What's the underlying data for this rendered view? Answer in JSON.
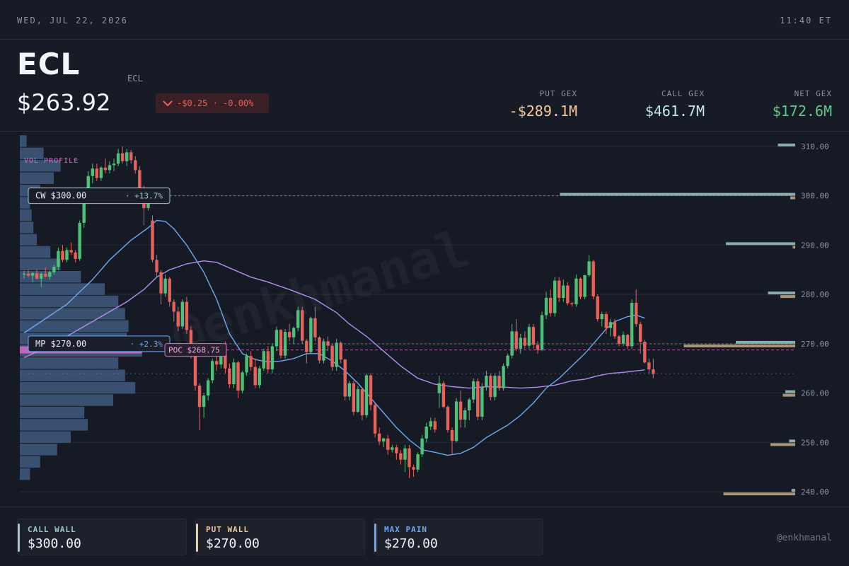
{
  "topbar": {
    "date": "WED, JUL 22, 2026",
    "time": "11:40 ET"
  },
  "header": {
    "ticker": "ECL",
    "ticker_sub": "ECL",
    "price": "$263.92",
    "change": "-$0.25 · -0.00%",
    "gex": [
      {
        "label": "PUT GEX",
        "value": "-$289.1M",
        "color": "#f2c99a"
      },
      {
        "label": "CALL GEX",
        "value": "$461.7M",
        "color": "#bfe8ea"
      },
      {
        "label": "NET GEX",
        "value": "$172.6M",
        "color": "#63c98a"
      }
    ]
  },
  "colors": {
    "up": "#4fc07a",
    "down": "#e8615a",
    "ma_fast": "#6fa8f0",
    "ma_slow": "#b48cf0",
    "vol": "#3f5a7e",
    "poc": "#e06ad0",
    "call": "#9fc7c7",
    "put": "#c4ad86"
  },
  "chart_data": {
    "type": "candlestick",
    "watermark": "@enkhmanal",
    "ylim": [
      237,
      313
    ],
    "yticks": [
      "310.00",
      "300.00",
      "290.00",
      "280.00",
      "270.00",
      "260.00",
      "250.00",
      "240.00"
    ],
    "ytick_values": [
      310,
      300,
      290,
      280,
      270,
      260,
      250,
      240
    ],
    "volume_profile_label": "VOL PROFILE",
    "volume_profile": [
      {
        "price": 311,
        "w": 0.04
      },
      {
        "price": 308.5,
        "w": 0.14
      },
      {
        "price": 306,
        "w": 0.24
      },
      {
        "price": 303.5,
        "w": 0.2
      },
      {
        "price": 301,
        "w": 0.12
      },
      {
        "price": 298.5,
        "w": 0.06
      },
      {
        "price": 296,
        "w": 0.07
      },
      {
        "price": 293.5,
        "w": 0.08
      },
      {
        "price": 291,
        "w": 0.1
      },
      {
        "price": 288.5,
        "w": 0.18
      },
      {
        "price": 286,
        "w": 0.24
      },
      {
        "price": 283.5,
        "w": 0.36
      },
      {
        "price": 281,
        "w": 0.5
      },
      {
        "price": 278.5,
        "w": 0.58
      },
      {
        "price": 276,
        "w": 0.62
      },
      {
        "price": 273.5,
        "w": 0.64
      },
      {
        "price": 271,
        "w": 0.63
      },
      {
        "price": 268.5,
        "w": 0.72
      },
      {
        "price": 266,
        "w": 0.58
      },
      {
        "price": 263.5,
        "w": 0.62
      },
      {
        "price": 261,
        "w": 0.68
      },
      {
        "price": 258.5,
        "w": 0.55
      },
      {
        "price": 256,
        "w": 0.38
      },
      {
        "price": 253.5,
        "w": 0.4
      },
      {
        "price": 251,
        "w": 0.3
      },
      {
        "price": 248.5,
        "w": 0.22
      },
      {
        "price": 246,
        "w": 0.12
      },
      {
        "price": 243.5,
        "w": 0.06
      }
    ],
    "candles": [
      [
        284,
        284.8,
        283.2,
        284.2
      ],
      [
        284.2,
        285,
        283.5,
        283.8
      ],
      [
        283.8,
        284.5,
        282.5,
        284.3
      ],
      [
        284.3,
        285,
        283,
        283.2
      ],
      [
        283.2,
        284.5,
        281.5,
        284.2
      ],
      [
        284.2,
        285.5,
        283.5,
        283.6
      ],
      [
        283.6,
        284.8,
        283,
        284.5
      ],
      [
        284.5,
        286,
        284,
        285.6
      ],
      [
        285.6,
        289.5,
        285,
        288.8
      ],
      [
        288.8,
        290,
        286.5,
        287
      ],
      [
        287,
        289.5,
        286.5,
        289
      ],
      [
        289,
        290.5,
        288,
        288.5
      ],
      [
        288.5,
        289,
        286.5,
        287.2
      ],
      [
        287.2,
        295,
        286.8,
        294.5
      ],
      [
        294.5,
        300,
        293.5,
        299.5
      ],
      [
        299.5,
        305,
        299,
        304
      ],
      [
        304,
        306.5,
        302.5,
        305.5
      ],
      [
        305.5,
        306.5,
        303,
        303.6
      ],
      [
        303.6,
        306,
        303,
        305.7
      ],
      [
        305.7,
        307.5,
        304.5,
        305.2
      ],
      [
        305.2,
        307,
        304.5,
        306.2
      ],
      [
        306.2,
        307.5,
        305,
        306.5
      ],
      [
        306.5,
        309.5,
        306,
        308.6
      ],
      [
        308.6,
        310,
        306.5,
        307
      ],
      [
        307,
        309.5,
        306,
        308.8
      ],
      [
        308.8,
        309.3,
        306.5,
        307.2
      ],
      [
        307.2,
        308,
        304.5,
        305.2
      ],
      [
        305.2,
        306,
        301,
        301.5
      ],
      [
        301.5,
        302,
        294,
        297.5
      ],
      [
        297.5,
        301,
        297,
        300.5
      ],
      [
        295,
        296,
        286.5,
        287
      ],
      [
        287,
        288,
        283.5,
        284.5
      ],
      [
        284.5,
        285,
        278,
        280.2
      ],
      [
        280.2,
        284,
        279.5,
        283.2
      ],
      [
        283.2,
        283.5,
        277.5,
        278.5
      ],
      [
        278.5,
        279,
        274.5,
        276.5
      ],
      [
        276.5,
        277.5,
        272.5,
        273.5
      ],
      [
        273.5,
        279,
        273,
        278.5
      ],
      [
        278.5,
        279.5,
        272,
        272.8
      ],
      [
        272.8,
        273.5,
        267,
        267.5
      ],
      [
        267.5,
        268,
        260.5,
        261.5
      ],
      [
        261.5,
        262,
        252.5,
        257.2
      ],
      [
        257.2,
        260,
        255,
        259.5
      ],
      [
        259.5,
        263,
        258.5,
        262.6
      ],
      [
        262.6,
        267,
        262,
        266.5
      ],
      [
        266.5,
        270,
        264.5,
        265.8
      ],
      [
        265.8,
        270,
        265,
        269.6
      ],
      [
        269.6,
        270.5,
        264,
        265
      ],
      [
        265,
        266,
        261,
        261.8
      ],
      [
        261.8,
        267,
        261,
        266.2
      ],
      [
        266.2,
        266.5,
        259,
        260.5
      ],
      [
        260.5,
        264.5,
        260,
        264.2
      ],
      [
        264.2,
        268,
        263.5,
        267.5
      ],
      [
        267.5,
        268.5,
        264.5,
        265.3
      ],
      [
        265.3,
        267,
        261,
        261.6
      ],
      [
        261.6,
        265.5,
        261,
        265
      ],
      [
        265,
        269,
        264.5,
        268.5
      ],
      [
        268.5,
        269.5,
        264,
        264.8
      ],
      [
        264.8,
        270,
        264,
        269.5
      ],
      [
        269.5,
        273.5,
        268.5,
        272.8
      ],
      [
        272.8,
        273,
        267,
        267.6
      ],
      [
        267.6,
        273,
        267,
        272.4
      ],
      [
        272.4,
        274,
        270.5,
        271.3
      ],
      [
        271.3,
        273.5,
        270,
        273.2
      ],
      [
        273.2,
        277.5,
        272.5,
        276.8
      ],
      [
        276.8,
        277.5,
        270,
        270.6
      ],
      [
        270.6,
        271,
        266,
        268.3
      ],
      [
        268.3,
        275.5,
        268,
        275.2
      ],
      [
        275.2,
        277.5,
        270.5,
        271.3
      ],
      [
        271.3,
        271.5,
        266,
        266.6
      ],
      [
        266.6,
        271,
        266,
        270.5
      ],
      [
        270.5,
        271.5,
        268.5,
        269.6
      ],
      [
        269.6,
        270,
        264.5,
        265.3
      ],
      [
        265.3,
        271,
        264.5,
        270.2
      ],
      [
        270.2,
        270.5,
        266,
        266.8
      ],
      [
        266.8,
        267,
        258.5,
        259.3
      ],
      [
        259.3,
        262.5,
        258.5,
        262
      ],
      [
        262,
        262.5,
        255.5,
        256.2
      ],
      [
        256.2,
        261.5,
        256,
        260.8
      ],
      [
        260.8,
        261,
        254.5,
        255.5
      ],
      [
        255.5,
        264,
        255,
        263.6
      ],
      [
        263.6,
        264,
        256.5,
        257.6
      ],
      [
        257.6,
        258,
        251,
        251.8
      ],
      [
        251.8,
        253,
        249.5,
        250.2
      ],
      [
        250.2,
        251,
        249,
        250.8
      ],
      [
        250.8,
        251.5,
        247.5,
        248.5
      ],
      [
        248.5,
        249.5,
        248,
        249
      ],
      [
        249,
        249.5,
        246.5,
        247.8
      ],
      [
        247.8,
        248.5,
        245.5,
        246.5
      ],
      [
        246.5,
        249.5,
        244,
        248.8
      ],
      [
        248.8,
        249.5,
        242.8,
        245
      ],
      [
        245,
        245.5,
        243,
        244.5
      ],
      [
        244.5,
        248,
        244,
        247.6
      ],
      [
        247.6,
        251.5,
        247,
        250.8
      ],
      [
        250.8,
        254,
        250,
        253.2
      ],
      [
        253.2,
        255,
        252.5,
        254.3
      ],
      [
        254.3,
        255,
        252,
        252.6
      ],
      [
        260,
        263.5,
        257,
        262
      ],
      [
        262,
        262.5,
        257,
        257.2
      ],
      [
        257.2,
        257.5,
        252,
        252.5
      ],
      [
        252.5,
        253,
        247.5,
        250.3
      ],
      [
        250.3,
        259,
        250,
        258.3
      ],
      [
        258.3,
        260.5,
        253,
        254.6
      ],
      [
        254.6,
        257,
        253,
        256.5
      ],
      [
        256.5,
        259,
        254.5,
        258.7
      ],
      [
        258.7,
        263,
        258,
        262.4
      ],
      [
        262.4,
        263,
        254.5,
        255.2
      ],
      [
        255.2,
        262,
        254.5,
        261.3
      ],
      [
        261.3,
        264.5,
        260.5,
        263.5
      ],
      [
        263.5,
        264,
        258.5,
        259.2
      ],
      [
        259.2,
        264,
        258.5,
        263.5
      ],
      [
        263.5,
        264.5,
        260.5,
        261
      ],
      [
        261,
        266,
        260.5,
        265.5
      ],
      [
        265.5,
        268,
        265,
        267.6
      ],
      [
        267.6,
        274,
        267,
        272.5
      ],
      [
        272.5,
        275,
        268.5,
        269
      ],
      [
        269,
        272,
        268,
        271.2
      ],
      [
        271.2,
        272.5,
        269,
        269.6
      ],
      [
        269.6,
        274,
        269,
        273.4
      ],
      [
        273.4,
        274,
        269,
        269.8
      ],
      [
        269.8,
        270.5,
        268,
        268.8
      ],
      [
        268.8,
        276.5,
        268.5,
        275.8
      ],
      [
        275.8,
        280.5,
        275,
        279.3
      ],
      [
        279.3,
        281,
        275.5,
        276.2
      ],
      [
        276.2,
        283.5,
        275.5,
        282.8
      ],
      [
        282.8,
        283.5,
        278.5,
        279.3
      ],
      [
        279.3,
        283,
        278.5,
        281.8
      ],
      [
        281.8,
        282.5,
        277.8,
        278.2
      ],
      [
        278.2,
        278.5,
        277.5,
        278
      ],
      [
        278,
        284,
        277.5,
        283.2
      ],
      [
        283.2,
        283.5,
        279,
        279.5
      ],
      [
        279.5,
        284,
        279,
        283.9
      ],
      [
        283.9,
        288,
        283.5,
        286.7
      ],
      [
        286.7,
        287,
        279,
        279.6
      ],
      [
        279.6,
        280,
        274.5,
        275
      ],
      [
        275,
        276.5,
        273.5,
        276
      ],
      [
        276,
        276.5,
        272,
        273.2
      ],
      [
        273.2,
        275,
        271.5,
        274.4
      ],
      [
        274.4,
        275,
        271,
        271.5
      ],
      [
        271.5,
        271.8,
        269.5,
        270
      ],
      [
        270,
        272.5,
        269.5,
        271.8
      ],
      [
        271.8,
        272,
        269,
        269.5
      ],
      [
        269.5,
        279,
        269,
        278.3
      ],
      [
        278.3,
        281,
        273.5,
        274
      ],
      [
        274,
        274.5,
        268,
        270.4
      ],
      [
        270.4,
        270.8,
        266,
        266.2
      ],
      [
        266.2,
        267,
        264,
        264.8
      ],
      [
        264.8,
        267,
        263,
        263.9
      ]
    ],
    "ma_fast": [
      [
        0,
        272.2
      ],
      [
        4,
        274.5
      ],
      [
        10,
        278
      ],
      [
        16,
        283
      ],
      [
        20,
        287
      ],
      [
        25,
        291
      ],
      [
        29,
        293.5
      ],
      [
        31,
        295
      ],
      [
        33,
        294.8
      ],
      [
        35,
        293.3
      ],
      [
        38,
        290
      ],
      [
        42,
        284.5
      ],
      [
        45,
        279
      ],
      [
        48,
        272
      ],
      [
        51,
        268
      ],
      [
        54,
        266.8
      ],
      [
        57,
        266.3
      ],
      [
        60,
        266.5
      ],
      [
        63,
        267
      ],
      [
        66,
        268
      ],
      [
        69,
        268
      ],
      [
        72,
        266.5
      ],
      [
        75,
        264.5
      ],
      [
        78,
        262
      ],
      [
        81,
        259
      ],
      [
        84,
        256
      ],
      [
        87,
        253
      ],
      [
        90,
        250.5
      ],
      [
        93,
        248.5
      ],
      [
        96,
        248
      ],
      [
        99,
        247.4
      ],
      [
        102,
        247.8
      ],
      [
        105,
        249
      ],
      [
        108,
        251
      ],
      [
        111,
        252.5
      ],
      [
        113,
        253.5
      ],
      [
        116,
        255.5
      ],
      [
        119,
        258
      ],
      [
        122,
        261
      ],
      [
        125,
        263
      ],
      [
        128,
        265.5
      ],
      [
        131,
        268
      ],
      [
        133,
        270
      ],
      [
        136,
        273
      ],
      [
        138,
        274.5
      ],
      [
        141,
        275.5
      ],
      [
        143,
        275.8
      ],
      [
        145,
        275.2
      ]
    ],
    "ma_slow": [
      [
        0,
        267.2
      ],
      [
        6,
        269.5
      ],
      [
        12,
        272.5
      ],
      [
        18,
        275.5
      ],
      [
        24,
        278.5
      ],
      [
        28,
        281
      ],
      [
        31,
        283.5
      ],
      [
        34,
        285
      ],
      [
        38,
        286.2
      ],
      [
        42,
        286.8
      ],
      [
        45,
        286.5
      ],
      [
        49,
        285
      ],
      [
        53,
        283.5
      ],
      [
        57,
        282.5
      ],
      [
        62,
        281
      ],
      [
        68,
        279
      ],
      [
        73,
        276.3
      ],
      [
        76,
        274
      ],
      [
        80,
        271.5
      ],
      [
        84,
        268.5
      ],
      [
        88,
        265.5
      ],
      [
        92,
        263
      ],
      [
        96,
        261.8
      ],
      [
        100,
        261.3
      ],
      [
        104,
        261
      ],
      [
        108,
        261.3
      ],
      [
        112,
        261.2
      ],
      [
        116,
        261
      ],
      [
        120,
        261.2
      ],
      [
        124,
        261.6
      ],
      [
        128,
        262.5
      ],
      [
        131,
        262.8
      ],
      [
        134,
        263.5
      ],
      [
        137,
        264
      ],
      [
        140,
        264.2
      ],
      [
        143,
        264.5
      ],
      [
        145,
        264.7
      ]
    ],
    "levels": [
      {
        "name": "CW",
        "price": 300,
        "label": "CW $300.00",
        "pct": "+13.7%",
        "color": "#9fc7c7"
      },
      {
        "name": "MP",
        "price": 270,
        "label": "MP $270.00",
        "pct": "+2.3%",
        "color": "#6fa8f0"
      }
    ],
    "poc": {
      "price": 268.75,
      "label": "POC $268.75"
    },
    "last_price": 263.92,
    "gex_bars": [
      {
        "price": 310,
        "call": 0.07,
        "put": 0
      },
      {
        "price": 300,
        "call": 0.95,
        "put": 0.02
      },
      {
        "price": 290,
        "call": 0.28,
        "put": 0.01
      },
      {
        "price": 280,
        "call": 0.11,
        "put": 0.06
      },
      {
        "price": 270,
        "call": 0.24,
        "put": 0.45
      },
      {
        "price": 260,
        "call": 0.04,
        "put": 0.05
      },
      {
        "price": 250,
        "call": 0.025,
        "put": 0.1
      },
      {
        "price": 240,
        "call": 0.015,
        "put": 0.29
      }
    ]
  },
  "footer": {
    "cards": [
      {
        "label": "CALL WALL",
        "value": "$300.00",
        "color": "#9fc7c7"
      },
      {
        "label": "PUT WALL",
        "value": "$270.00",
        "color": "#f2c99a"
      },
      {
        "label": "MAX PAIN",
        "value": "$270.00",
        "color": "#6fa8f0"
      }
    ],
    "handle": "@enkhmanal"
  }
}
